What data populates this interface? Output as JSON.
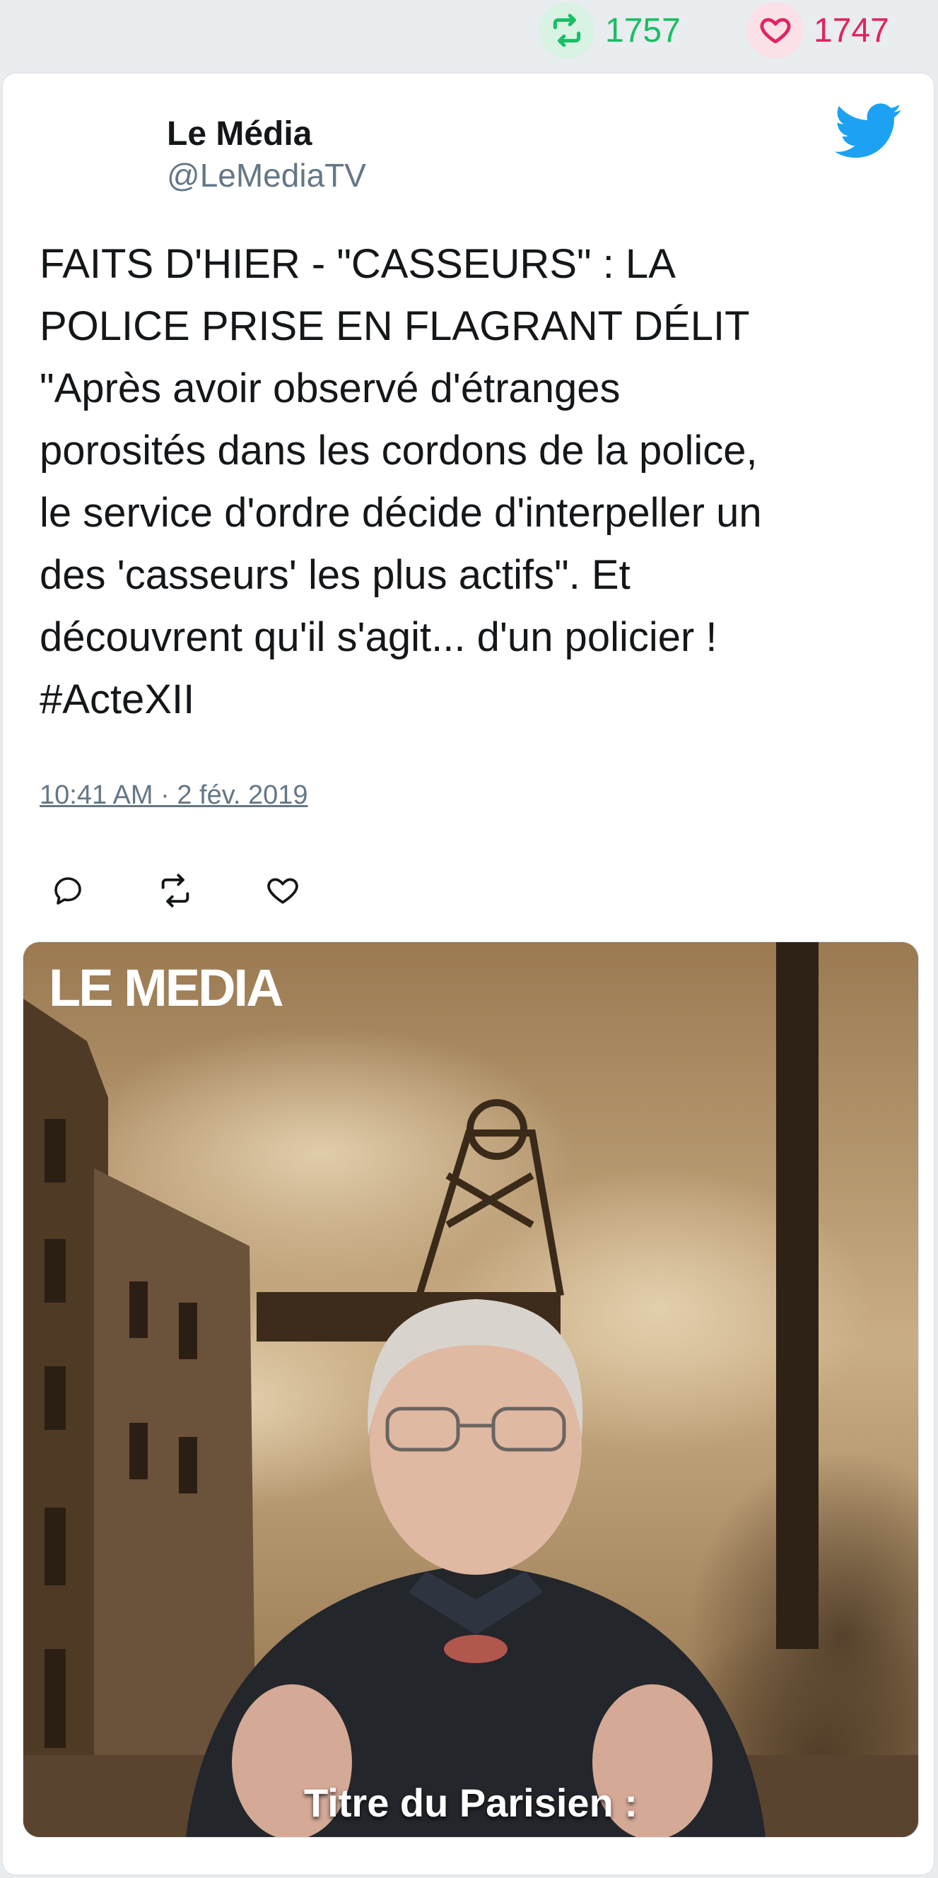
{
  "stats": {
    "retweets": "1757",
    "likes": "1747"
  },
  "tweet": {
    "author_name": "Le Média",
    "author_handle": "@LeMediaTV",
    "text": "FAITS D'HIER - \"CASSEURS\" : LA\nPOLICE PRISE EN FLAGRANT DÉLIT\n\"Après avoir observé d'étranges\nporosités dans les cordons de la police,\nle service d'ordre décide d'interpeller un\ndes 'casseurs' les plus actifs\". Et\ndécouvrent qu'il s'agit... d'un policier !\n#ActeXII",
    "timestamp": "10:41 AM · 2 fév. 2019"
  },
  "media": {
    "logo_text": "LE MEDIA",
    "caption": "Titre du Parisien :"
  },
  "icons": {
    "retweet": "retweet-icon",
    "like": "heart-icon",
    "reply": "reply-icon",
    "brand": "twitter-bird-icon"
  },
  "colors": {
    "retweet": "#17bf63",
    "like": "#e0245e",
    "twitter_blue": "#1da1f2",
    "text": "#14171a",
    "secondary": "#657786"
  }
}
